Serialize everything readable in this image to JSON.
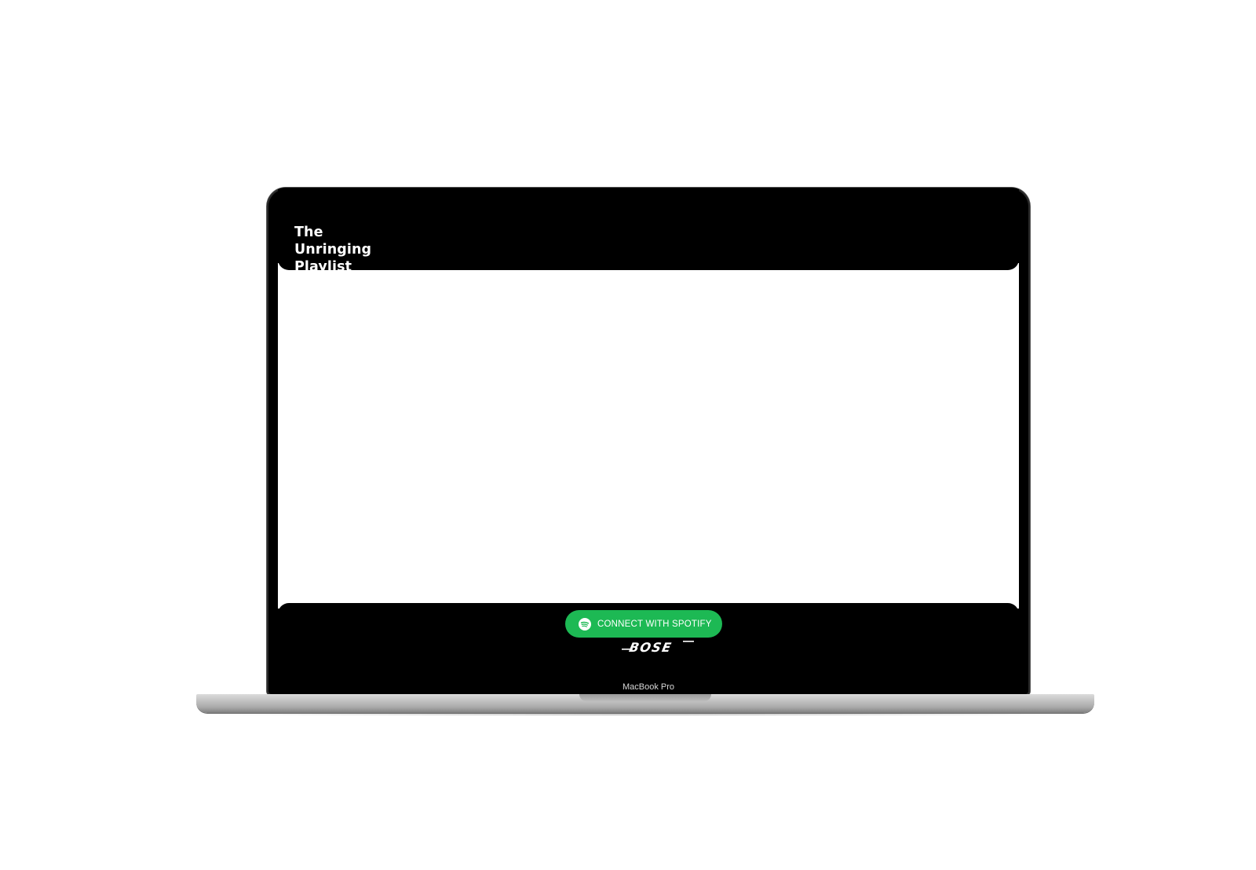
{
  "site": {
    "title_line1": "The",
    "title_line2": "Unringing",
    "title_line3": "Playlist"
  },
  "connect_button": {
    "label": "CONNECT WITH SPOTIFY",
    "icon": "spotify-icon",
    "color": "#1db954"
  },
  "footer": {
    "logo_text": "BOSE",
    "logo_icon": "bose-logo"
  },
  "device": {
    "label": "MacBook Pro"
  }
}
